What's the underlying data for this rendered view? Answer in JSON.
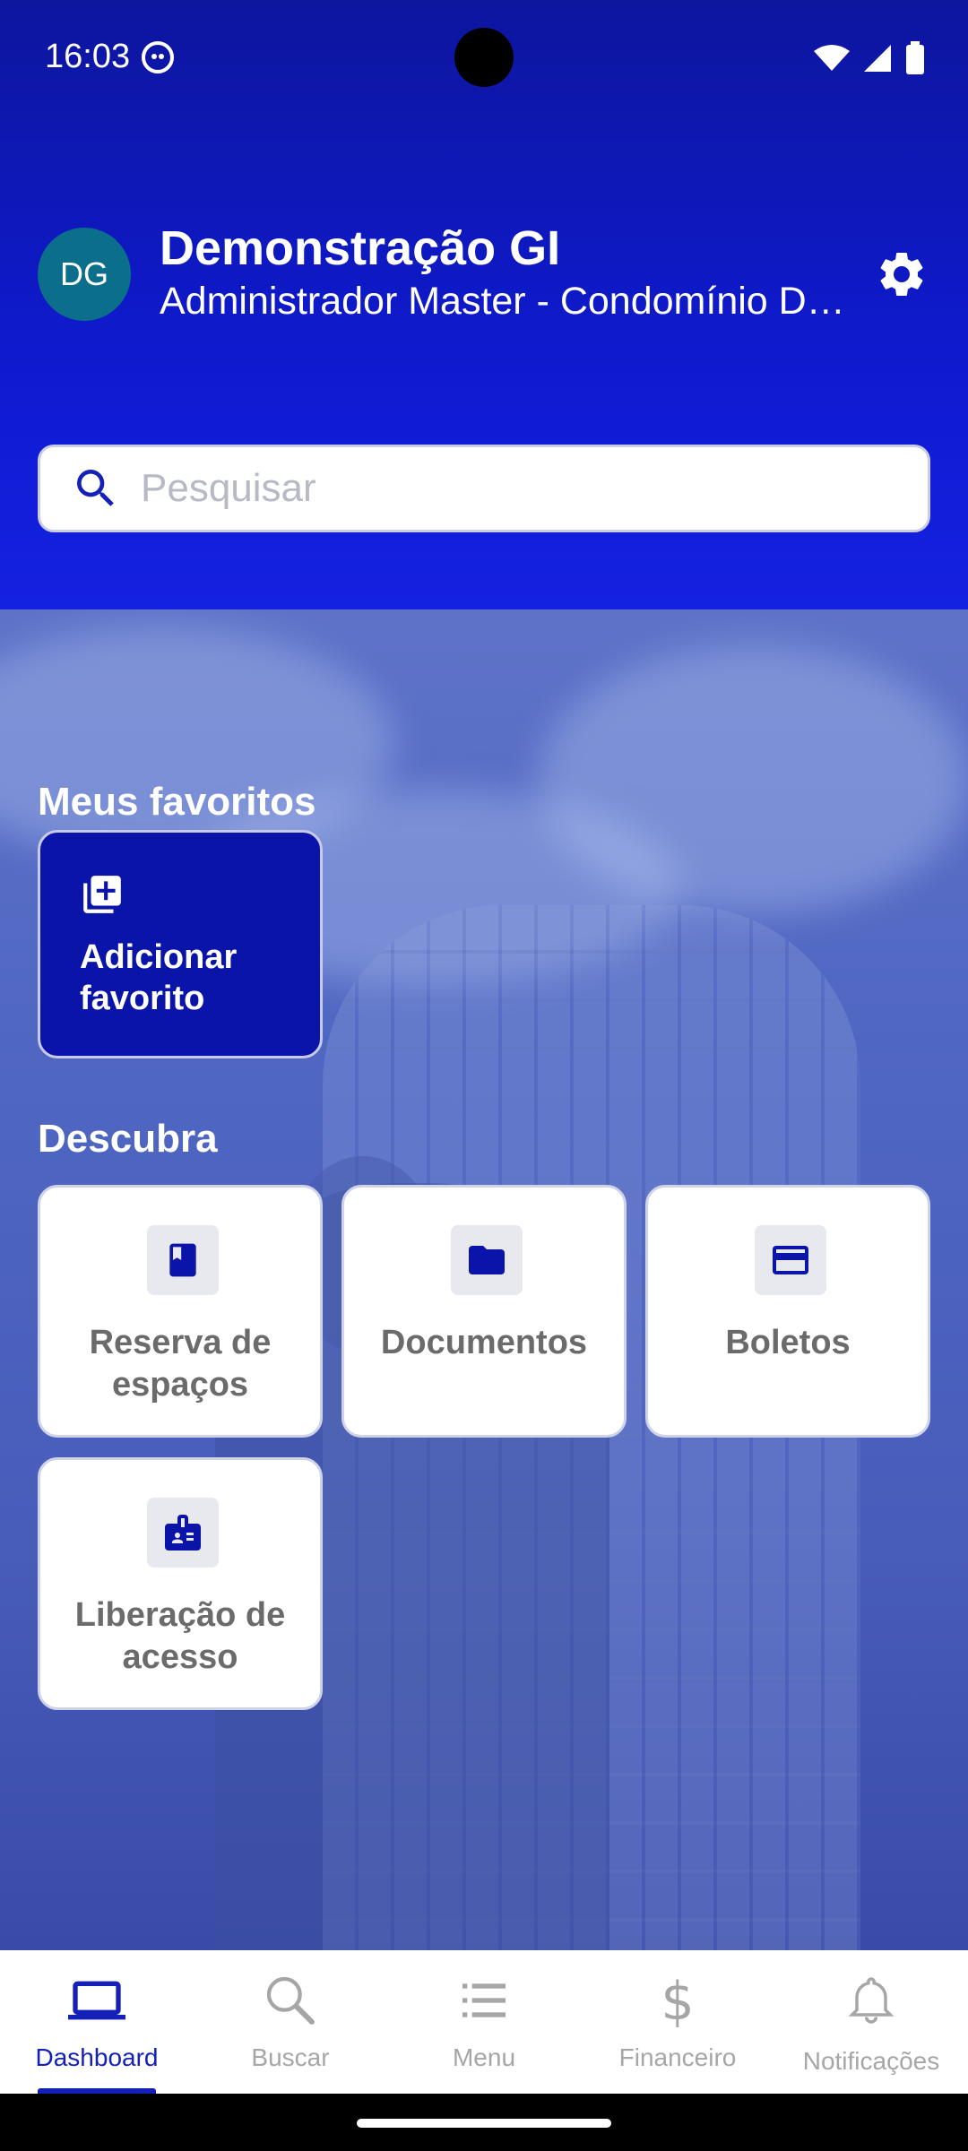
{
  "status_bar": {
    "time": "16:03"
  },
  "header": {
    "avatar_initials": "DG",
    "user_name": "Demonstração GI",
    "user_role": "Administrador Master - Condomínio Demonstração"
  },
  "search": {
    "placeholder": "Pesquisar",
    "value": ""
  },
  "favorites": {
    "title": "Meus favoritos",
    "add_label": "Adicionar favorito"
  },
  "discover": {
    "title": "Descubra",
    "items": [
      {
        "label": "Reserva de espaços",
        "icon": "book-icon"
      },
      {
        "label": "Documentos",
        "icon": "folder-icon"
      },
      {
        "label": "Boletos",
        "icon": "credit-card-icon"
      },
      {
        "label": "Liberação de acesso",
        "icon": "badge-icon"
      }
    ]
  },
  "bottom_nav": {
    "items": [
      {
        "label": "Dashboard",
        "icon": "laptop-icon",
        "active": true
      },
      {
        "label": "Buscar",
        "icon": "magnifier-icon",
        "active": false
      },
      {
        "label": "Menu",
        "icon": "list-icon",
        "active": false
      },
      {
        "label": "Financeiro",
        "icon": "dollar-icon",
        "active": false
      },
      {
        "label": "Notificações",
        "icon": "bell-icon",
        "active": false
      }
    ]
  },
  "colors": {
    "primary": "#0b14a8",
    "header_bg": "#0f1ad0",
    "avatar_bg": "#0b6e8a",
    "nav_active": "#1420b8",
    "nav_inactive": "#a6a6a6"
  }
}
